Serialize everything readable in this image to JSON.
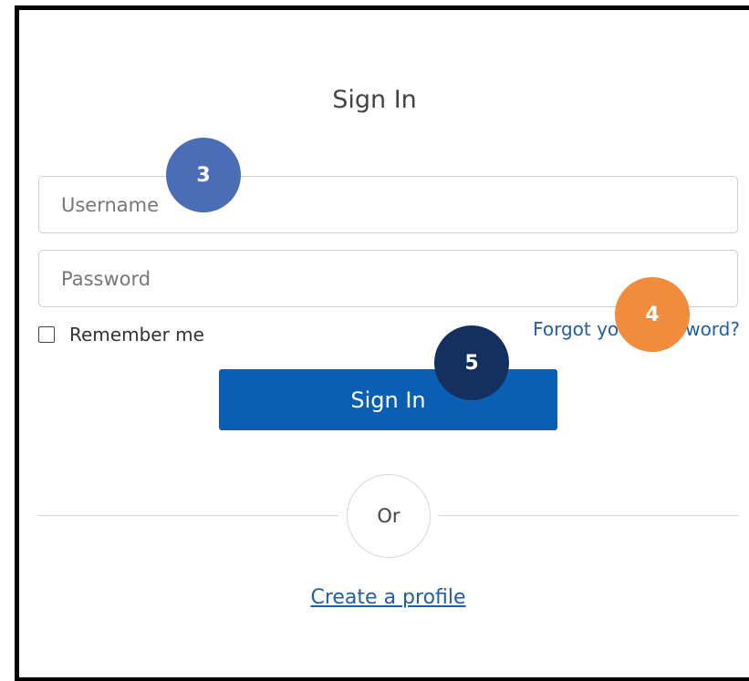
{
  "title": "Sign In",
  "username": {
    "placeholder": "Username",
    "value": ""
  },
  "password": {
    "placeholder": "Password",
    "value": ""
  },
  "remember": {
    "label": "Remember me",
    "checked": false
  },
  "forgot_password": {
    "label": "Forgot your password?"
  },
  "signin_button": {
    "label": "Sign In"
  },
  "divider": {
    "label": "Or"
  },
  "create_profile": {
    "label": "Create a profile"
  },
  "badges": [
    {
      "number": "3",
      "color": "#4a6db5"
    },
    {
      "number": "4",
      "color": "#f08c3c"
    },
    {
      "number": "5",
      "color": "#14305e"
    }
  ],
  "colors": {
    "primary_button": "#0a5fb4",
    "link": "#1f5ea8"
  }
}
